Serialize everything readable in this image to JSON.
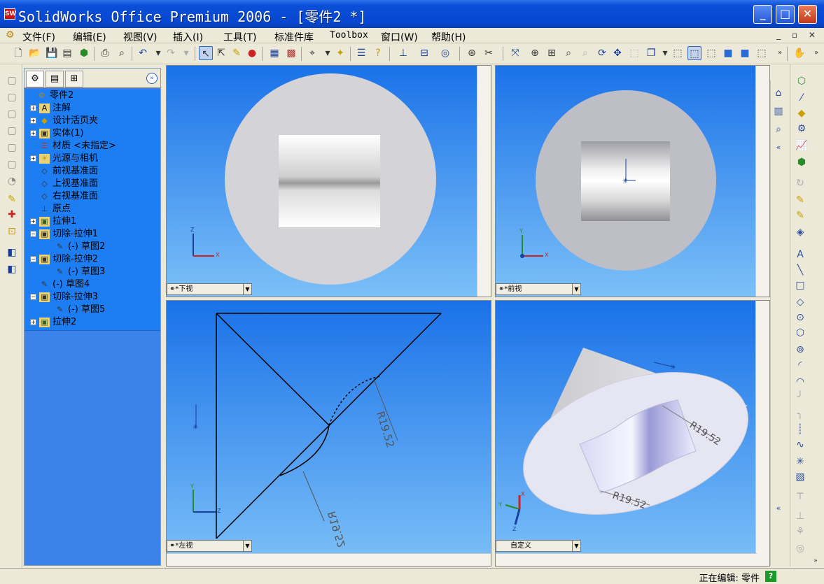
{
  "window": {
    "title": "SolidWorks Office Premium 2006 - [零件2 *]",
    "logo_text": "SW"
  },
  "menu": [
    "文件(F)",
    "编辑(E)",
    "视图(V)",
    "插入(I)",
    "工具(T)",
    "标准件库",
    "Toolbox",
    "窗口(W)",
    "帮助(H)"
  ],
  "tree": {
    "root": "零件2",
    "items": [
      {
        "label": "注解",
        "expand": "+",
        "icon": "annotation-icon"
      },
      {
        "label": "设计活页夹",
        "expand": "+",
        "icon": "design-binder-icon"
      },
      {
        "label": "实体(1)",
        "expand": "+",
        "icon": "solid-bodies-icon"
      },
      {
        "label": "材质 <未指定>",
        "expand": "",
        "icon": "material-icon"
      },
      {
        "label": "光源与相机",
        "expand": "+",
        "icon": "lights-cameras-icon"
      },
      {
        "label": "前视基准面",
        "expand": "",
        "icon": "plane-icon"
      },
      {
        "label": "上视基准面",
        "expand": "",
        "icon": "plane-icon"
      },
      {
        "label": "右视基准面",
        "expand": "",
        "icon": "plane-icon"
      },
      {
        "label": "原点",
        "expand": "",
        "icon": "origin-icon"
      },
      {
        "label": "拉伸1",
        "expand": "+",
        "icon": "extrude-icon"
      },
      {
        "label": "切除-拉伸1",
        "expand": "-",
        "icon": "cut-extrude-icon"
      },
      {
        "label": "(-) 草图2",
        "expand": "",
        "icon": "sketch-icon",
        "indent": 1
      },
      {
        "label": "切除-拉伸2",
        "expand": "-",
        "icon": "cut-extrude-icon"
      },
      {
        "label": "(-) 草图3",
        "expand": "",
        "icon": "sketch-icon",
        "indent": 1
      },
      {
        "label": "(-) 草图4",
        "expand": "",
        "icon": "sketch-icon"
      },
      {
        "label": "切除-拉伸3",
        "expand": "-",
        "icon": "cut-extrude-icon"
      },
      {
        "label": "(-) 草图5",
        "expand": "",
        "icon": "sketch-icon",
        "indent": 1
      },
      {
        "label": "拉伸2",
        "expand": "+",
        "icon": "extrude-icon"
      }
    ]
  },
  "viewports": {
    "bottom": {
      "label": "*下视",
      "axis_a": "Z",
      "axis_b": "X"
    },
    "front": {
      "label": "*前视",
      "axis_a": "Y",
      "axis_b": "X"
    },
    "left": {
      "label": "*左视",
      "axis_a": "Y",
      "axis_b": "Z",
      "dim1": "R19.52",
      "dim2": "R19.52"
    },
    "custom": {
      "label": "自定义",
      "axis_a": "Y",
      "axis_b": "X",
      "axis_c": "Z",
      "dim1": "R19.52",
      "dim2": "R19.52"
    }
  },
  "status": {
    "text": "正在编辑: 零件",
    "help": "?"
  },
  "colors": {
    "accent": "#0747d1",
    "viewport_top": "#1a72e8",
    "viewport_bottom": "#7cc0f8",
    "tree_bg": "#1c7ef2"
  }
}
